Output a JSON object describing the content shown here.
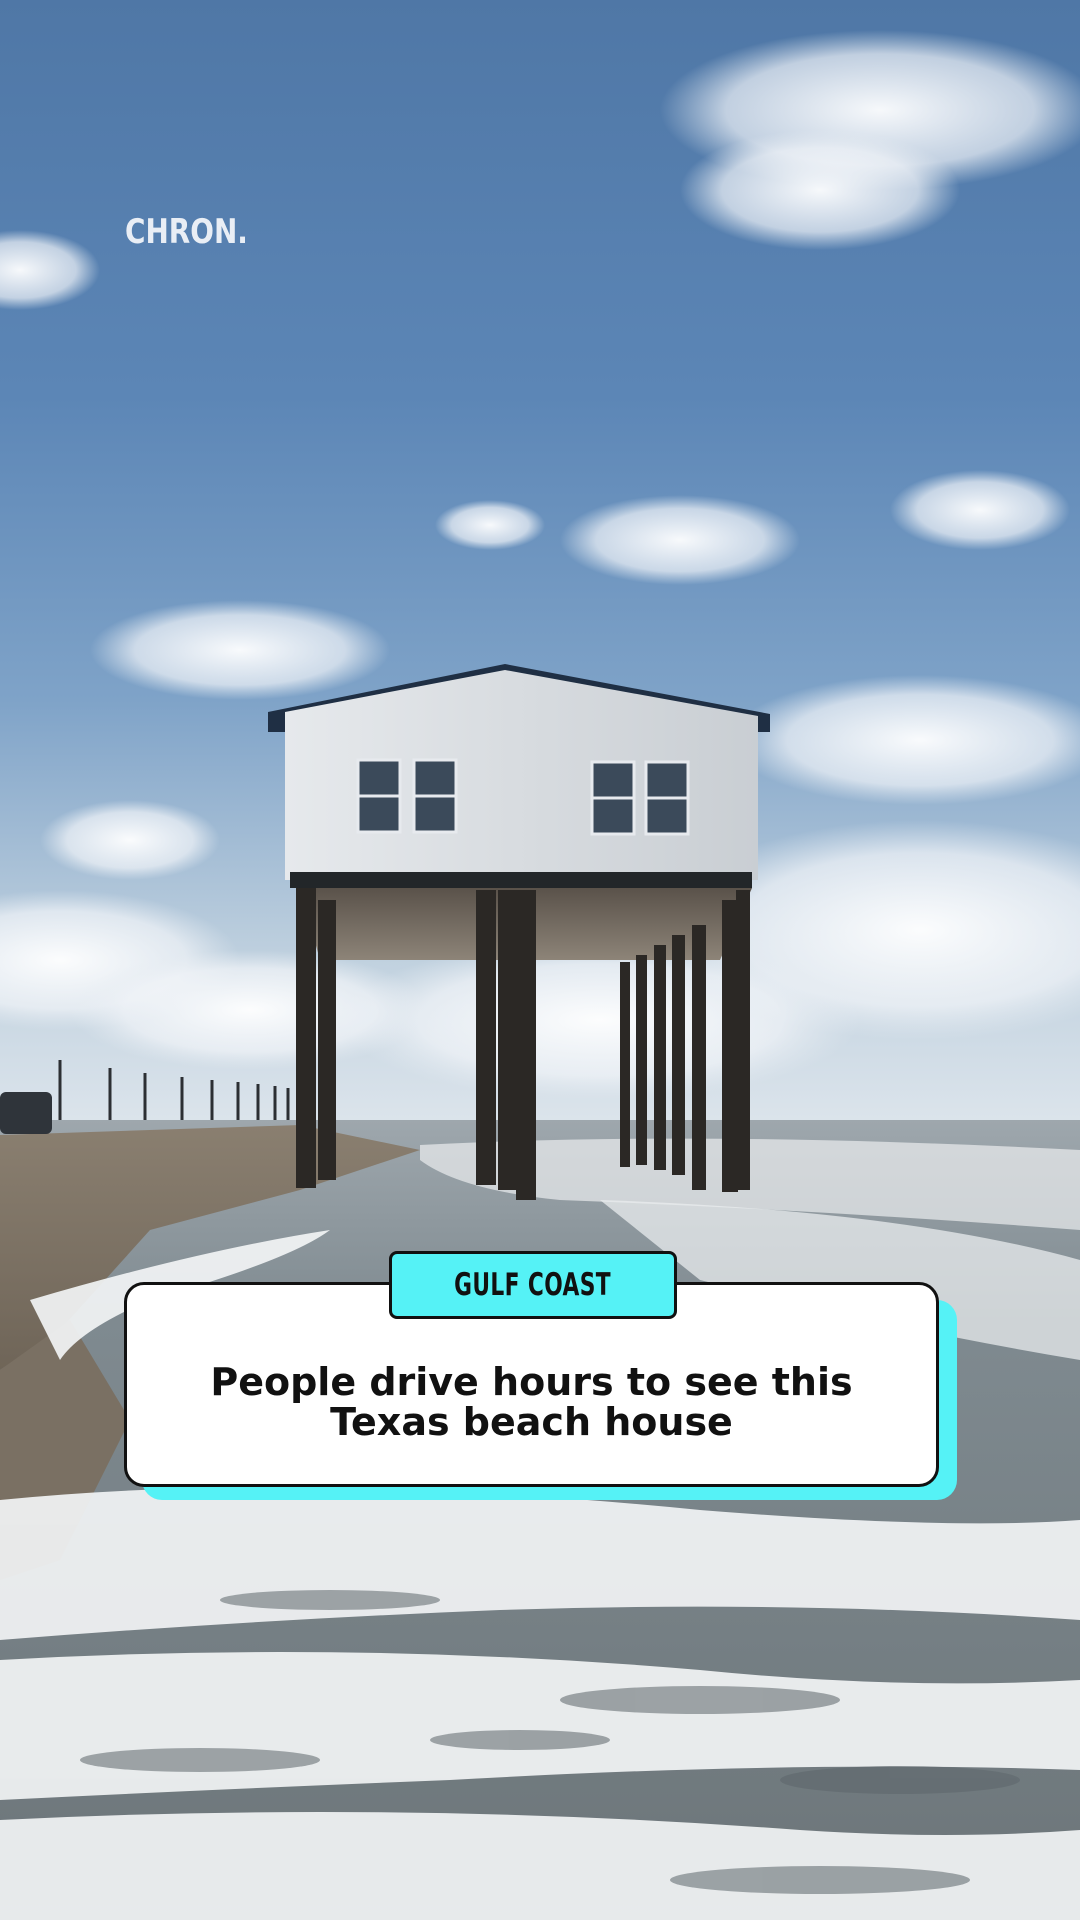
{
  "watermark": {
    "text": "CHRON."
  },
  "caption": {
    "tag": "GULF COAST",
    "title": "People drive hours to see this Texas beach house"
  },
  "colors": {
    "accent": "#55f2f6",
    "card_background": "#ffffff",
    "card_border": "#111111"
  },
  "scene": {
    "subject": "house-on-stilts",
    "setting": "beach-surf"
  }
}
